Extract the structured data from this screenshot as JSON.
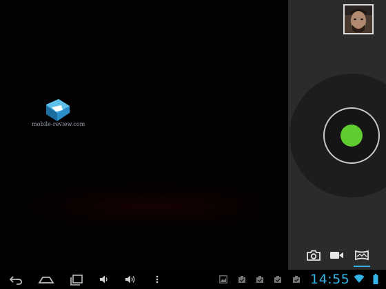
{
  "watermark": {
    "text": "mobile-review.com"
  },
  "camera": {
    "modes": [
      {
        "label": "",
        "icon": "camera-icon"
      },
      {
        "label": "",
        "icon": "video-camera-icon"
      },
      {
        "label": "",
        "icon": "panorama-icon"
      }
    ],
    "selected_mode": "panorama",
    "shutter_color": "#5fcc30"
  },
  "status": {
    "time": "14:55",
    "accent": "#33b5e5"
  }
}
